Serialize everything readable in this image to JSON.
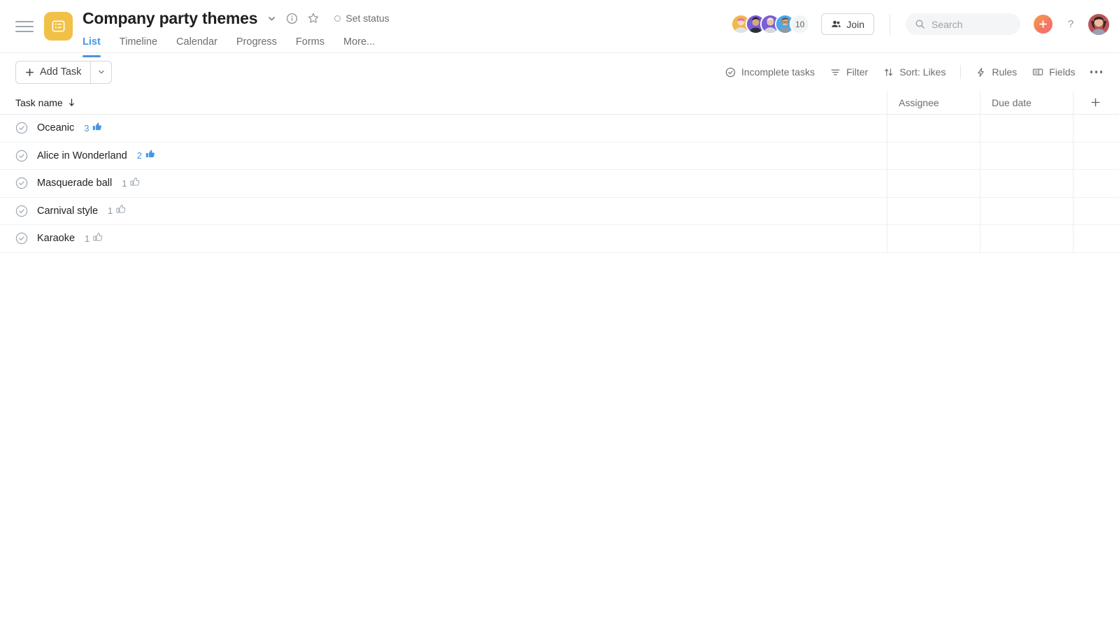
{
  "header": {
    "menu_icon": "hamburger-icon",
    "project_icon": "list-project-icon",
    "project_icon_color": "#f1c046",
    "title": "Company party themes",
    "title_caret_icon": "chevron-down-icon",
    "info_icon": "info-circle-icon",
    "star_icon": "star-outline-icon",
    "set_status_label": "Set status",
    "tabs": [
      {
        "label": "List",
        "active": true
      },
      {
        "label": "Timeline",
        "active": false
      },
      {
        "label": "Calendar",
        "active": false
      },
      {
        "label": "Progress",
        "active": false
      },
      {
        "label": "Forms",
        "active": false
      },
      {
        "label": "More...",
        "active": false
      }
    ],
    "accent_color": "#4796e3",
    "members": {
      "avatar_colors": [
        "#f0b949",
        "#7a5ed6",
        "#7a5ed6",
        "#4aa8e8"
      ],
      "overflow_count": "10"
    },
    "join_label": "Join",
    "join_icon": "people-icon",
    "search": {
      "icon": "search-icon",
      "placeholder": "Search",
      "value": ""
    },
    "plus_icon": "plus-icon",
    "help_icon": "question-mark-icon",
    "account_avatar": "user-avatar"
  },
  "toolbar": {
    "add_task_label": "Add Task",
    "add_task_icon": "plus-icon",
    "add_task_caret_icon": "chevron-down-icon",
    "right_items": [
      {
        "label": "Incomplete tasks",
        "icon": "check-circle-icon"
      },
      {
        "label": "Filter",
        "icon": "filter-icon"
      },
      {
        "label": "Sort: Likes",
        "icon": "sort-arrows-icon"
      },
      {
        "label": "Rules",
        "icon": "lightning-bolt-icon"
      },
      {
        "label": "Fields",
        "icon": "fields-icon"
      }
    ],
    "more_icon": "ellipsis-icon"
  },
  "table": {
    "columns": [
      {
        "label": "Task name",
        "sort_icon": "arrow-down-icon"
      },
      {
        "label": "Assignee"
      },
      {
        "label": "Due date"
      }
    ],
    "add_column_icon": "plus-icon",
    "rows": [
      {
        "name": "Oceanic",
        "likes": "3",
        "liked": true,
        "assignee": "",
        "due_date": ""
      },
      {
        "name": "Alice in Wonderland",
        "likes": "2",
        "liked": true,
        "assignee": "",
        "due_date": ""
      },
      {
        "name": "Masquerade ball",
        "likes": "1",
        "liked": false,
        "assignee": "",
        "due_date": ""
      },
      {
        "name": "Carnival style",
        "likes": "1",
        "liked": false,
        "assignee": "",
        "due_date": ""
      },
      {
        "name": "Karaoke",
        "likes": "1",
        "liked": false,
        "assignee": "",
        "due_date": ""
      }
    ]
  }
}
